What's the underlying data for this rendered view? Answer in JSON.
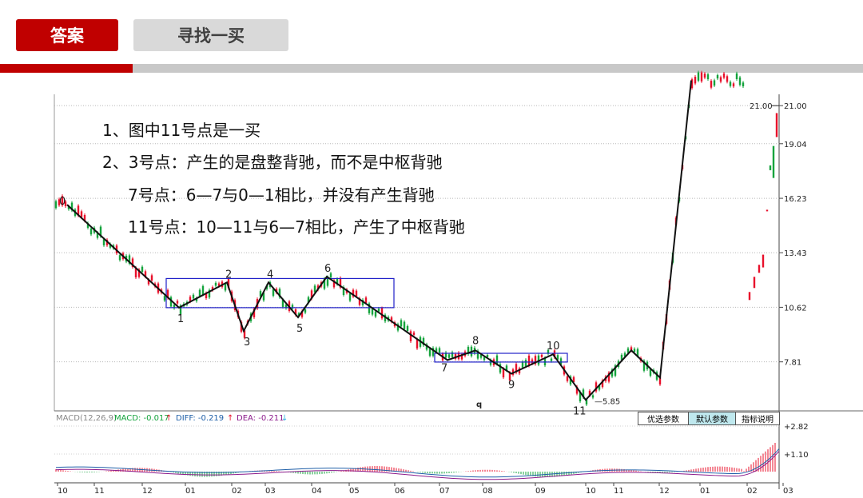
{
  "tabs": {
    "answer": "答案",
    "find": "寻找一买"
  },
  "notes": [
    "1、图中11号点是一买",
    "2、3号点：产生的是盘整背驰，而不是中枢背驰",
    "7号点：6—7与0—1相比，并没有产生背驰",
    "11号点：10—11与6—7相比，产生了中枢背驰"
  ],
  "indicator": {
    "macd_label": "MACD(12,26,9)",
    "macd": "MACD: -0.017",
    "diff": "DIFF: -0.219",
    "dea": "DEA: -0.211",
    "arrow_up": "↑",
    "arrow_down": "↓",
    "buttons": [
      "优选参数",
      "默认参数",
      "指标说明"
    ],
    "yticks": [
      "2.82",
      "1.10"
    ]
  },
  "colors": {
    "accent_red": "#c00000",
    "up_red": "#e8102b",
    "down_green": "#14a33c",
    "box_blue": "#2020c8"
  },
  "chart_data": {
    "type": "line",
    "title": "",
    "ylim": [
      4.5,
      22.5
    ],
    "yticks": [
      21.0,
      19.04,
      16.23,
      13.43,
      10.62,
      7.81
    ],
    "ytick_labels": [
      "21.00",
      "19.04",
      "16.23",
      "13.43",
      "10.62",
      "7.81"
    ],
    "xticks": [
      "10",
      "11",
      "12",
      "01",
      "02",
      "03",
      "04",
      "05",
      "06",
      "07",
      "08",
      "09",
      "10",
      "11",
      "12",
      "01",
      "02",
      "03"
    ],
    "stroke_points": [
      {
        "label": "0",
        "month": "10",
        "price": 15.9
      },
      {
        "label": "1",
        "month": "12",
        "price": 10.6
      },
      {
        "label": "2",
        "month": "02",
        "price": 11.9
      },
      {
        "label": "3",
        "month": "02",
        "price": 9.4
      },
      {
        "label": "4",
        "month": "03",
        "price": 11.9
      },
      {
        "label": "5",
        "month": "04",
        "price": 10.1
      },
      {
        "label": "6",
        "month": "04",
        "price": 12.2
      },
      {
        "label": "7",
        "month": "07",
        "price": 7.9
      },
      {
        "label": "8",
        "month": "08",
        "price": 8.4
      },
      {
        "label": "9",
        "month": "08",
        "price": 7.2
      },
      {
        "label": "10",
        "month": "09",
        "price": 8.2
      },
      {
        "label": "11",
        "month": "10",
        "price": 5.85
      },
      {
        "label": "",
        "month": "12",
        "price": 8.4
      },
      {
        "label": "",
        "month": "12",
        "price": 7.0
      },
      {
        "label": "",
        "month": "02",
        "price": 22.3
      }
    ],
    "annotations": [
      "5.85",
      "21.00",
      "q"
    ],
    "zones": [
      {
        "from": "1",
        "to": "6",
        "low": 10.6,
        "high": 12.1
      },
      {
        "from": "7",
        "to": "10",
        "low": 7.8,
        "high": 8.25
      }
    ]
  }
}
